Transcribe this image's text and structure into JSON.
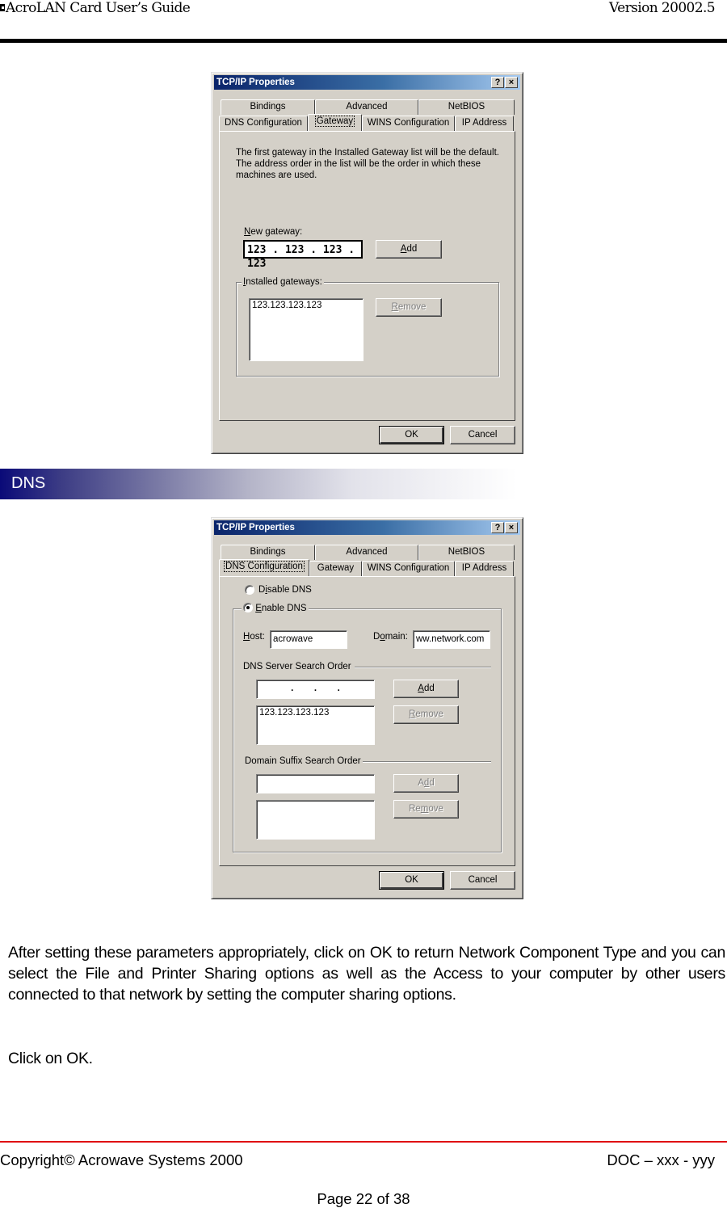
{
  "header": {
    "title": "AcroLAN Card User’s Guide",
    "version": "Version 20002.5"
  },
  "dialogs": [
    {
      "title": "TCP/IP Properties",
      "help_label": "?",
      "close_label": "×",
      "tabs_row1": [
        "Bindings",
        "Advanced",
        "NetBIOS"
      ],
      "tabs_row2": [
        "DNS Configuration",
        "Gateway",
        "WINS Configuration",
        "IP Address"
      ],
      "active_tab": "Gateway",
      "gateway": {
        "description": [
          "The first gateway in the Installed Gateway list will be the default.",
          "The address order in the list will be the order in which these",
          "machines are used."
        ],
        "new_gateway_label_u": "N",
        "new_gateway_label_rest": "ew gateway:",
        "new_gateway_value": "123 . 123 . 123 . 123",
        "add_u": "A",
        "add_rest": "dd",
        "installed_label_u": "I",
        "installed_label_rest": "nstalled gateways:",
        "installed_items": [
          "123.123.123.123"
        ],
        "remove_u": "R",
        "remove_rest": "emove"
      },
      "ok_label": "OK",
      "cancel_label": "Cancel"
    },
    {
      "title": "TCP/IP Properties",
      "help_label": "?",
      "close_label": "×",
      "tabs_row1": [
        "Bindings",
        "Advanced",
        "NetBIOS"
      ],
      "tabs_row2": [
        "DNS Configuration",
        "Gateway",
        "WINS Configuration",
        "IP Address"
      ],
      "active_tab": "DNS Configuration",
      "dns": {
        "disable_pre": "D",
        "disable_u": "i",
        "disable_rest": "sable DNS",
        "disable_selected": false,
        "enable_u": "E",
        "enable_rest": "nable DNS",
        "enable_selected": true,
        "host_u": "H",
        "host_rest": "ost:",
        "host_value": "acrowave",
        "domain_pre": "D",
        "domain_u": "o",
        "domain_rest": "main:",
        "domain_value": "ww.network.com",
        "server_order_label": "DNS Server Search Order",
        "server_input_value": ".        .        .",
        "server_add_u": "A",
        "server_add_rest": "dd",
        "server_items": [
          "123.123.123.123"
        ],
        "server_remove_u": "R",
        "server_remove_rest": "emove",
        "suffix_order_label": "Domain Suffix Search Order",
        "suffix_input_value": "",
        "suffix_add_pre": "A",
        "suffix_add_u": "d",
        "suffix_add_rest": "d",
        "suffix_remove_pre": "Re",
        "suffix_remove_u": "m",
        "suffix_remove_rest": "ove"
      },
      "ok_label": "OK",
      "cancel_label": "Cancel"
    }
  ],
  "section": {
    "heading": "DNS"
  },
  "body": {
    "paragraph": "After setting these parameters appropriately, click on OK to return Network Component Type and you can select the File and Printer Sharing options as well as the Access to your computer by other users connected to that network by setting the computer sharing options.",
    "click_ok": "Click on OK."
  },
  "footer": {
    "copyright": "Copyright© Acrowave Systems 2000",
    "doc_id": "DOC – xxx - yyy",
    "page": "Page 22 of 38"
  },
  "colors": {
    "footer_rule": "#e0000b",
    "dialog_face": "#d4d0c8",
    "titlebar_start": "#0a246a",
    "banner_start": "#0a0a78"
  }
}
